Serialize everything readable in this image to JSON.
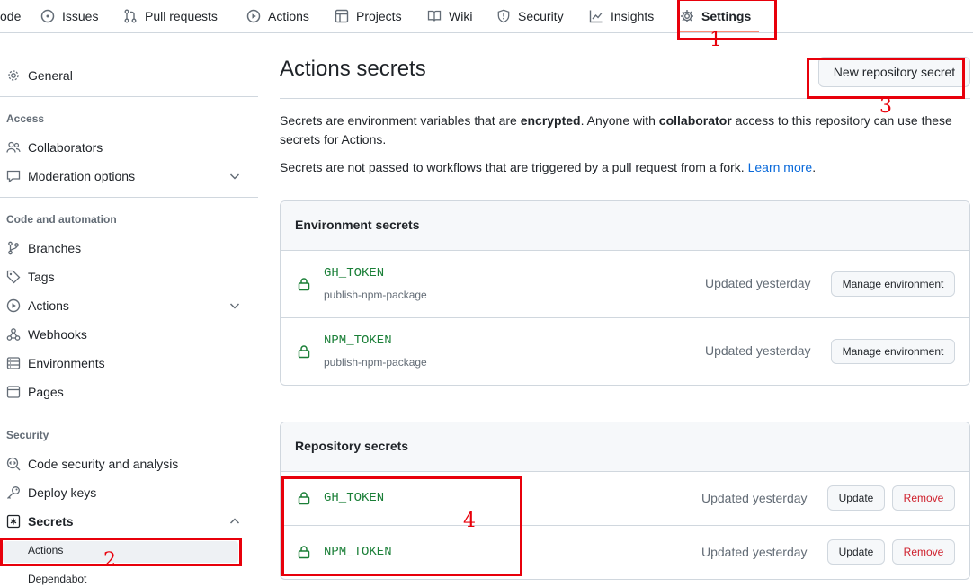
{
  "nav": {
    "items": [
      {
        "label": "ode",
        "icon": "none"
      },
      {
        "label": "Issues",
        "icon": "issue-icon"
      },
      {
        "label": "Pull requests",
        "icon": "pull-request-icon"
      },
      {
        "label": "Actions",
        "icon": "play-icon"
      },
      {
        "label": "Projects",
        "icon": "table-icon"
      },
      {
        "label": "Wiki",
        "icon": "book-icon"
      },
      {
        "label": "Security",
        "icon": "shield-icon"
      },
      {
        "label": "Insights",
        "icon": "graph-icon"
      },
      {
        "label": "Settings",
        "icon": "gear-icon",
        "active": true
      }
    ]
  },
  "sidebar": {
    "general": "General",
    "access_heading": "Access",
    "collaborators": "Collaborators",
    "moderation": "Moderation options",
    "code_heading": "Code and automation",
    "branches": "Branches",
    "tags": "Tags",
    "actions": "Actions",
    "webhooks": "Webhooks",
    "environments": "Environments",
    "pages": "Pages",
    "security_heading": "Security",
    "code_security": "Code security and analysis",
    "deploy_keys": "Deploy keys",
    "secrets": "Secrets",
    "secrets_actions": "Actions",
    "secrets_dependabot": "Dependabot"
  },
  "main": {
    "title": "Actions secrets",
    "new_secret_button": "New repository secret",
    "intro": {
      "p1_a": "Secrets are environment variables that are ",
      "p1_b": "encrypted",
      "p1_c": ". Anyone with ",
      "p1_d": "collaborator",
      "p1_e": " access to this repository can use these",
      "p1_f": "secrets for Actions.",
      "p2_a": "Secrets are not passed to workflows that are triggered by a pull request from a fork. ",
      "p2_link": "Learn more",
      "p2_end": "."
    },
    "environment_secrets": {
      "heading": "Environment secrets",
      "rows": [
        {
          "name": "GH_TOKEN",
          "env": "publish-npm-package",
          "updated": "Updated yesterday",
          "button": "Manage environment"
        },
        {
          "name": "NPM_TOKEN",
          "env": "publish-npm-package",
          "updated": "Updated yesterday",
          "button": "Manage environment"
        }
      ]
    },
    "repository_secrets": {
      "heading": "Repository secrets",
      "rows": [
        {
          "name": "GH_TOKEN",
          "updated": "Updated yesterday",
          "update": "Update",
          "remove": "Remove"
        },
        {
          "name": "NPM_TOKEN",
          "updated": "Updated yesterday",
          "update": "Update",
          "remove": "Remove"
        }
      ]
    }
  },
  "annotations": [
    "1",
    "2",
    "3",
    "4"
  ],
  "colors": {
    "annotation": "#e8000b",
    "secret_name": "#1a7f37",
    "link": "#0969da",
    "nav_active_underline": "#fd8c73"
  }
}
